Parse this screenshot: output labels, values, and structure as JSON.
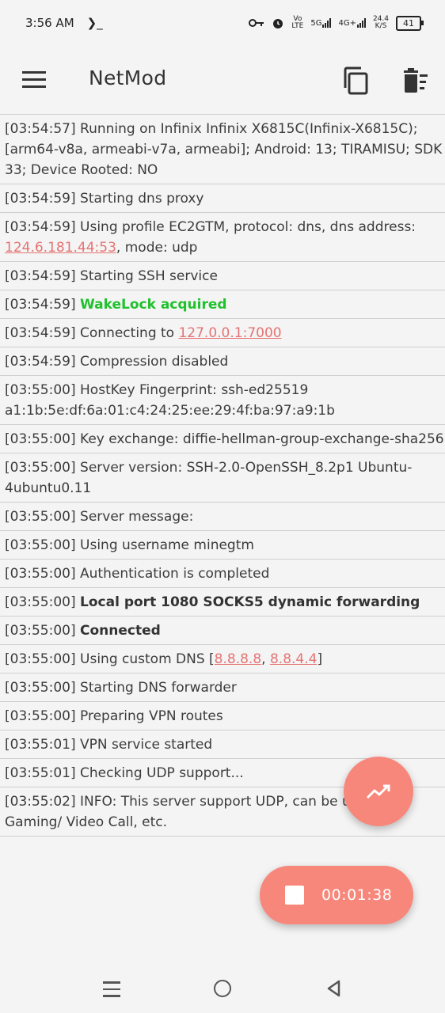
{
  "status_bar": {
    "time": "3:56 AM",
    "terminal_glyph": "❯_",
    "volte_top": "Vo",
    "volte_bottom": "LTE",
    "net1": "5G",
    "net2": "4G+",
    "speed_value": "24.4",
    "speed_unit": "K/S",
    "battery": "41"
  },
  "app_bar": {
    "title": "NetMod"
  },
  "log": [
    {
      "ts": "[03:54:57]",
      "parts": [
        {
          "t": " Running on Infinix Infinix X6815C(Infinix-X6815C); [arm64-v8a, armeabi-v7a, armeabi]; Android: 13; TIRAMISU; SDK 33; Device Rooted: NO",
          "s": "normal"
        }
      ]
    },
    {
      "ts": "[03:54:59]",
      "parts": [
        {
          "t": " Starting dns proxy",
          "s": "normal"
        }
      ]
    },
    {
      "ts": "[03:54:59]",
      "parts": [
        {
          "t": " Using profile EC2GTM, protocol: dns, dns address: ",
          "s": "normal"
        },
        {
          "t": "124.6.181.44:53",
          "s": "link"
        },
        {
          "t": ", mode: udp",
          "s": "normal"
        }
      ]
    },
    {
      "ts": "[03:54:59]",
      "parts": [
        {
          "t": " Starting SSH service",
          "s": "normal"
        }
      ]
    },
    {
      "ts": "[03:54:59]",
      "parts": [
        {
          "t": " ",
          "s": "normal"
        },
        {
          "t": "WakeLock acquired",
          "s": "green"
        }
      ]
    },
    {
      "ts": "[03:54:59]",
      "parts": [
        {
          "t": " Connecting to ",
          "s": "normal"
        },
        {
          "t": "127.0.0.1:7000",
          "s": "link"
        }
      ]
    },
    {
      "ts": "[03:54:59]",
      "parts": [
        {
          "t": " Compression disabled",
          "s": "normal"
        }
      ]
    },
    {
      "ts": "[03:55:00]",
      "parts": [
        {
          "t": " HostKey Fingerprint: ssh-ed25519 a1:1b:5e:df:6a:01:c4:24:25:ee:29:4f:ba:97:a9:1b",
          "s": "normal"
        }
      ]
    },
    {
      "ts": "[03:55:00]",
      "parts": [
        {
          "t": " Key exchange: diffie-hellman-group-exchange-sha256",
          "s": "normal"
        }
      ]
    },
    {
      "ts": "[03:55:00]",
      "parts": [
        {
          "t": " Server version: SSH-2.0-OpenSSH_8.2p1 Ubuntu-4ubuntu0.11",
          "s": "normal"
        }
      ]
    },
    {
      "ts": "[03:55:00]",
      "parts": [
        {
          "t": " Server message:",
          "s": "normal"
        }
      ]
    },
    {
      "ts": "[03:55:00]",
      "parts": [
        {
          "t": " Using username minegtm",
          "s": "normal"
        }
      ]
    },
    {
      "ts": "[03:55:00]",
      "parts": [
        {
          "t": " Authentication is completed",
          "s": "normal"
        }
      ]
    },
    {
      "ts": "[03:55:00]",
      "parts": [
        {
          "t": " ",
          "s": "normal"
        },
        {
          "t": "Local port 1080 SOCKS5 dynamic forwarding",
          "s": "bold"
        }
      ]
    },
    {
      "ts": "[03:55:00]",
      "parts": [
        {
          "t": " ",
          "s": "normal"
        },
        {
          "t": "Connected",
          "s": "bold"
        }
      ]
    },
    {
      "ts": "[03:55:00]",
      "parts": [
        {
          "t": " Using custom DNS [",
          "s": "normal"
        },
        {
          "t": "8.8.8.8",
          "s": "link"
        },
        {
          "t": ", ",
          "s": "normal"
        },
        {
          "t": "8.8.4.4",
          "s": "link"
        },
        {
          "t": "]",
          "s": "normal"
        }
      ]
    },
    {
      "ts": "[03:55:00]",
      "parts": [
        {
          "t": " Starting DNS forwarder",
          "s": "normal"
        }
      ]
    },
    {
      "ts": "[03:55:00]",
      "parts": [
        {
          "t": " Preparing VPN routes",
          "s": "normal"
        }
      ]
    },
    {
      "ts": "[03:55:01]",
      "parts": [
        {
          "t": " VPN service started",
          "s": "normal"
        }
      ]
    },
    {
      "ts": "[03:55:01]",
      "parts": [
        {
          "t": " Checking UDP support...",
          "s": "normal"
        }
      ]
    },
    {
      "ts": "[03:55:02]",
      "parts": [
        {
          "t": " INFO: This server support UDP, can be used for Gaming/ Video Call, etc.",
          "s": "normal"
        }
      ]
    }
  ],
  "timer": {
    "elapsed": "00:01:38"
  },
  "icons": {
    "menu": "hamburger-menu-icon",
    "copy": "copy-icon",
    "delete": "delete-sweep-icon",
    "graph": "trending-up-icon",
    "stop": "stop-icon"
  },
  "colors": {
    "accent": "#f8877b",
    "link": "#e57373",
    "success": "#1fc12c"
  }
}
